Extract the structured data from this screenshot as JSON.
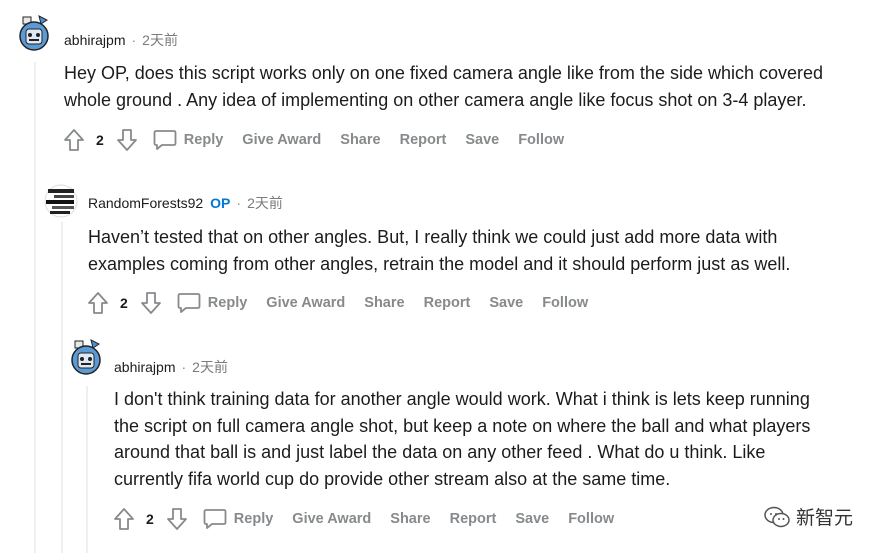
{
  "comments": [
    {
      "username": "abhirajpm",
      "op_badge": "",
      "time": "2天前",
      "avatar": "robot-avatar",
      "body": [
        "Hey OP, does this script works only on one fixed camera angle like from the side which covered",
        "whole ground . Any idea of implementing on other camera angle like focus shot on 3-4 player."
      ],
      "score": "2"
    },
    {
      "username": "RandomForests92",
      "op_badge": "OP",
      "time": "2天前",
      "avatar": "forest-avatar",
      "body": [
        "Haven’t tested that on other angles. But, I really think we could just add more data with",
        "examples coming from other angles, retrain the model and it should perform just as well."
      ],
      "score": "2"
    },
    {
      "username": "abhirajpm",
      "op_badge": "",
      "time": "2天前",
      "avatar": "robot-avatar",
      "body": [
        "I don't think training data for another angle would work. What i think is lets keep running",
        "the script on full camera angle shot, but keep a note on where the ball and what players",
        "around that ball is and just label the data on any other feed . What do u think. Like",
        "currently fifa world cup do provide other stream also at the same time."
      ],
      "score": "2"
    }
  ],
  "actions": {
    "reply": "Reply",
    "give_award": "Give Award",
    "share": "Share",
    "report": "Report",
    "save": "Save",
    "follow": "Follow"
  },
  "separator": "·",
  "watermark": "新智元",
  "colors": {
    "op_badge": "#0079d3",
    "action_text": "#878a8c",
    "thread_line": "#edeff1"
  }
}
